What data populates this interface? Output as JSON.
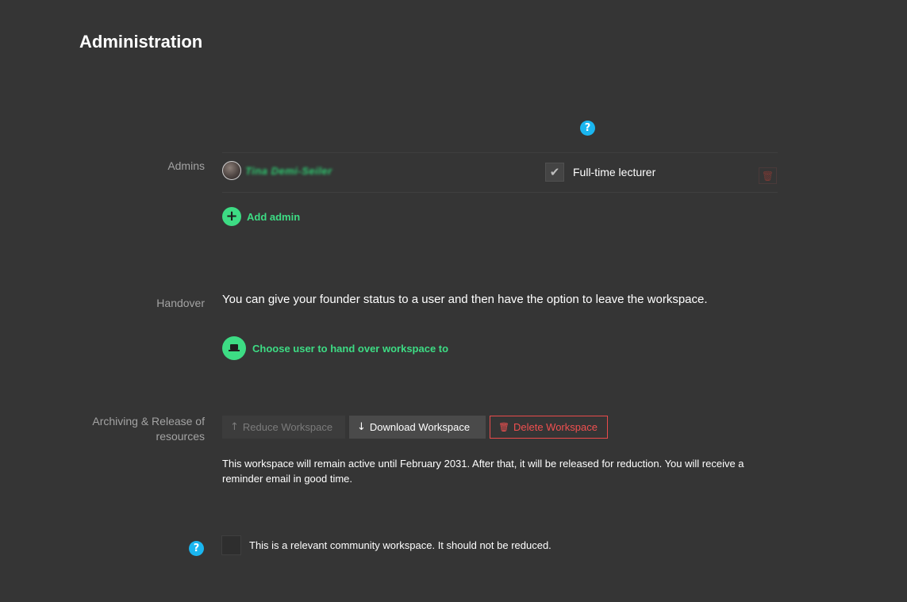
{
  "page": {
    "title": "Administration"
  },
  "admins": {
    "label": "Admins",
    "help_icon": "?",
    "items": [
      {
        "name": "Tina Demi-Seiler",
        "avatar_icon": "avatar",
        "checkbox_mark": "✔",
        "checkbox_label": "Full-time lecturer",
        "delete_icon": "🗑"
      }
    ],
    "add_icon": "+",
    "add_label": "Add admin"
  },
  "handover": {
    "label": "Handover",
    "description": "You can give your founder status to a user and then have the option to leave the workspace.",
    "action_icon": "laptop-icon",
    "action_label": "Choose user to hand over workspace to"
  },
  "archiving": {
    "label": "Archiving & Release of resources",
    "buttons": {
      "reduce_icon": "↑",
      "reduce_label": "Reduce Workspace",
      "download_icon": "↓",
      "download_label": "Download Workspace",
      "delete_icon": "🗑",
      "delete_label": "Delete Workspace"
    },
    "info_text": "This workspace will remain active until February 2031. After that, it will be released for reduction. You will receive a reminder email in good time."
  },
  "community": {
    "help_icon": "?",
    "label": "This is a relevant community workspace. It should not be reduced."
  },
  "colors": {
    "background": "#353535",
    "accent_green": "#3ddc84",
    "help_blue": "#1ab6f0",
    "danger_red": "#e94b4b"
  }
}
